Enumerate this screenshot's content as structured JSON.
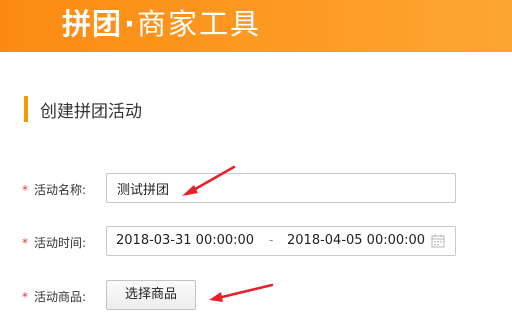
{
  "header": {
    "brand_bold": "拼团",
    "brand_dot": "·",
    "brand_rest": "商家工具"
  },
  "section": {
    "title": "创建拼团活动"
  },
  "form": {
    "required_mark": "*",
    "name": {
      "label": "活动名称:",
      "value": "测试拼团"
    },
    "time": {
      "label": "活动时间:",
      "start": "2018-03-31 00:00:00",
      "separator": "-",
      "end": "2018-04-05 00:00:00"
    },
    "goods": {
      "label": "活动商品:",
      "button_label": "选择商品"
    }
  },
  "colors": {
    "header_orange": "#fb8a12",
    "accent_bar": "#f39800",
    "required_red": "#e4393c",
    "annotation_arrow": "#e8202a"
  },
  "icons": [
    "calendar-icon",
    "red-arrow-annotation"
  ]
}
